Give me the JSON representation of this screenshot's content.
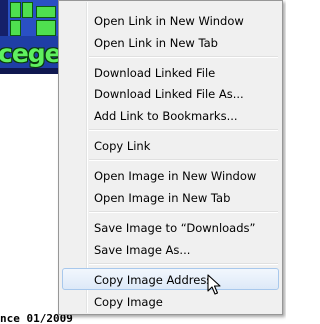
{
  "background": {
    "logo_text": "cege",
    "page_text": "nce 01/2009"
  },
  "context_menu": {
    "items": [
      {
        "label": "Open Link in New Window"
      },
      {
        "label": "Open Link in New Tab"
      },
      {
        "label": "Download Linked File"
      },
      {
        "label": "Download Linked File As..."
      },
      {
        "label": "Add Link to Bookmarks..."
      },
      {
        "label": "Copy Link"
      },
      {
        "label": "Open Image in New Window"
      },
      {
        "label": "Open Image in New Tab"
      },
      {
        "label": "Save Image to “Downloads”"
      },
      {
        "label": "Save Image As..."
      },
      {
        "label": "Copy Image Address",
        "highlighted": true
      },
      {
        "label": "Copy Image"
      }
    ]
  },
  "colors": {
    "menu_background": "#f0f0f0",
    "menu_border": "#979797",
    "highlight_border": "#a8c8ec",
    "logo_blue": "#1f3ea6",
    "logo_green": "#5ff05f"
  },
  "icons": {
    "cursor": "arrow-cursor-icon"
  }
}
